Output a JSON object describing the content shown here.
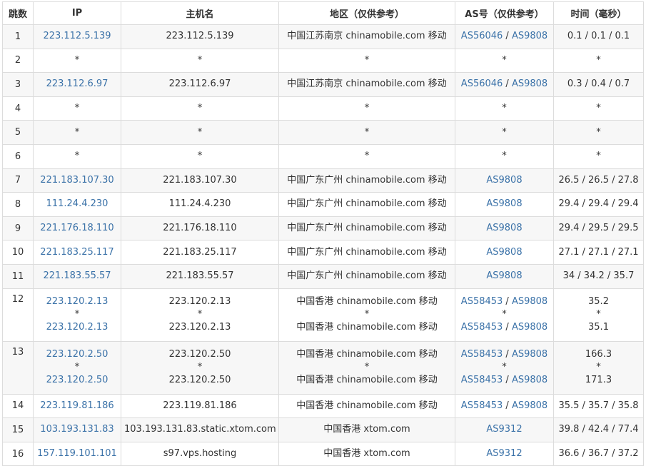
{
  "headers": {
    "hop": "跳数",
    "ip": "IP",
    "host": "主机名",
    "region": "地区（仅供参考）",
    "as": "AS号（仅供参考）",
    "time": "时间（毫秒）"
  },
  "rows": [
    {
      "hop": "1",
      "lines": [
        {
          "ip": "223.112.5.139",
          "host": "223.112.5.139",
          "region": "中国江苏南京 chinamobile.com 移动",
          "as": [
            "AS56046",
            "AS9808"
          ],
          "time": "0.1 / 0.1 / 0.1"
        }
      ]
    },
    {
      "hop": "2",
      "lines": [
        {
          "ip": "*",
          "host": "*",
          "region": "*",
          "as": [
            "*"
          ],
          "time": "*"
        }
      ]
    },
    {
      "hop": "3",
      "lines": [
        {
          "ip": "223.112.6.97",
          "host": "223.112.6.97",
          "region": "中国江苏南京 chinamobile.com 移动",
          "as": [
            "AS56046",
            "AS9808"
          ],
          "time": "0.3 / 0.4 / 0.7"
        }
      ]
    },
    {
      "hop": "4",
      "lines": [
        {
          "ip": "*",
          "host": "*",
          "region": "*",
          "as": [
            "*"
          ],
          "time": "*"
        }
      ]
    },
    {
      "hop": "5",
      "lines": [
        {
          "ip": "*",
          "host": "*",
          "region": "*",
          "as": [
            "*"
          ],
          "time": "*"
        }
      ]
    },
    {
      "hop": "6",
      "lines": [
        {
          "ip": "*",
          "host": "*",
          "region": "*",
          "as": [
            "*"
          ],
          "time": "*"
        }
      ]
    },
    {
      "hop": "7",
      "lines": [
        {
          "ip": "221.183.107.30",
          "host": "221.183.107.30",
          "region": "中国广东广州 chinamobile.com 移动",
          "as": [
            "AS9808"
          ],
          "time": "26.5 / 26.5 / 27.8"
        }
      ]
    },
    {
      "hop": "8",
      "lines": [
        {
          "ip": "111.24.4.230",
          "host": "111.24.4.230",
          "region": "中国广东广州 chinamobile.com 移动",
          "as": [
            "AS9808"
          ],
          "time": "29.4 / 29.4 / 29.4"
        }
      ]
    },
    {
      "hop": "9",
      "lines": [
        {
          "ip": "221.176.18.110",
          "host": "221.176.18.110",
          "region": "中国广东广州 chinamobile.com 移动",
          "as": [
            "AS9808"
          ],
          "time": "29.4 / 29.5 / 29.5"
        }
      ]
    },
    {
      "hop": "10",
      "lines": [
        {
          "ip": "221.183.25.117",
          "host": "221.183.25.117",
          "region": "中国广东广州 chinamobile.com 移动",
          "as": [
            "AS9808"
          ],
          "time": "27.1 / 27.1 / 27.1"
        }
      ]
    },
    {
      "hop": "11",
      "lines": [
        {
          "ip": "221.183.55.57",
          "host": "221.183.55.57",
          "region": "中国广东广州 chinamobile.com 移动",
          "as": [
            "AS9808"
          ],
          "time": "34 / 34.2 / 35.7"
        }
      ]
    },
    {
      "hop": "12",
      "lines": [
        {
          "ip": "223.120.2.13",
          "host": "223.120.2.13",
          "region": "中国香港 chinamobile.com 移动",
          "as": [
            "AS58453",
            "AS9808"
          ],
          "time": "35.2"
        },
        {
          "ip": "*",
          "host": "*",
          "region": "*",
          "as": [
            "*"
          ],
          "time": "*"
        },
        {
          "ip": "223.120.2.13",
          "host": "223.120.2.13",
          "region": "中国香港 chinamobile.com 移动",
          "as": [
            "AS58453",
            "AS9808"
          ],
          "time": "35.1"
        }
      ]
    },
    {
      "hop": "13",
      "lines": [
        {
          "ip": "223.120.2.50",
          "host": "223.120.2.50",
          "region": "中国香港 chinamobile.com 移动",
          "as": [
            "AS58453",
            "AS9808"
          ],
          "time": "166.3"
        },
        {
          "ip": "*",
          "host": "*",
          "region": "*",
          "as": [
            "*"
          ],
          "time": "*"
        },
        {
          "ip": "223.120.2.50",
          "host": "223.120.2.50",
          "region": "中国香港 chinamobile.com 移动",
          "as": [
            "AS58453",
            "AS9808"
          ],
          "time": "171.3"
        }
      ]
    },
    {
      "hop": "14",
      "lines": [
        {
          "ip": "223.119.81.186",
          "host": "223.119.81.186",
          "region": "中国香港 chinamobile.com 移动",
          "as": [
            "AS58453",
            "AS9808"
          ],
          "time": "35.5 / 35.7 / 35.8"
        }
      ]
    },
    {
      "hop": "15",
      "lines": [
        {
          "ip": "103.193.131.83",
          "host": "103.193.131.83.static.xtom.com",
          "region": "中国香港 xtom.com",
          "as": [
            "AS9312"
          ],
          "time": "39.8 / 42.4 / 77.4"
        }
      ]
    },
    {
      "hop": "16",
      "lines": [
        {
          "ip": "157.119.101.101",
          "host": "s97.vps.hosting",
          "region": "中国香港 xtom.com",
          "as": [
            "AS9312"
          ],
          "time": "36.6 / 36.7 / 37.2"
        }
      ]
    }
  ],
  "colors": {
    "link": "#3b72a8",
    "border": "#dcdcdc",
    "stripe": "#f7f7f7"
  }
}
